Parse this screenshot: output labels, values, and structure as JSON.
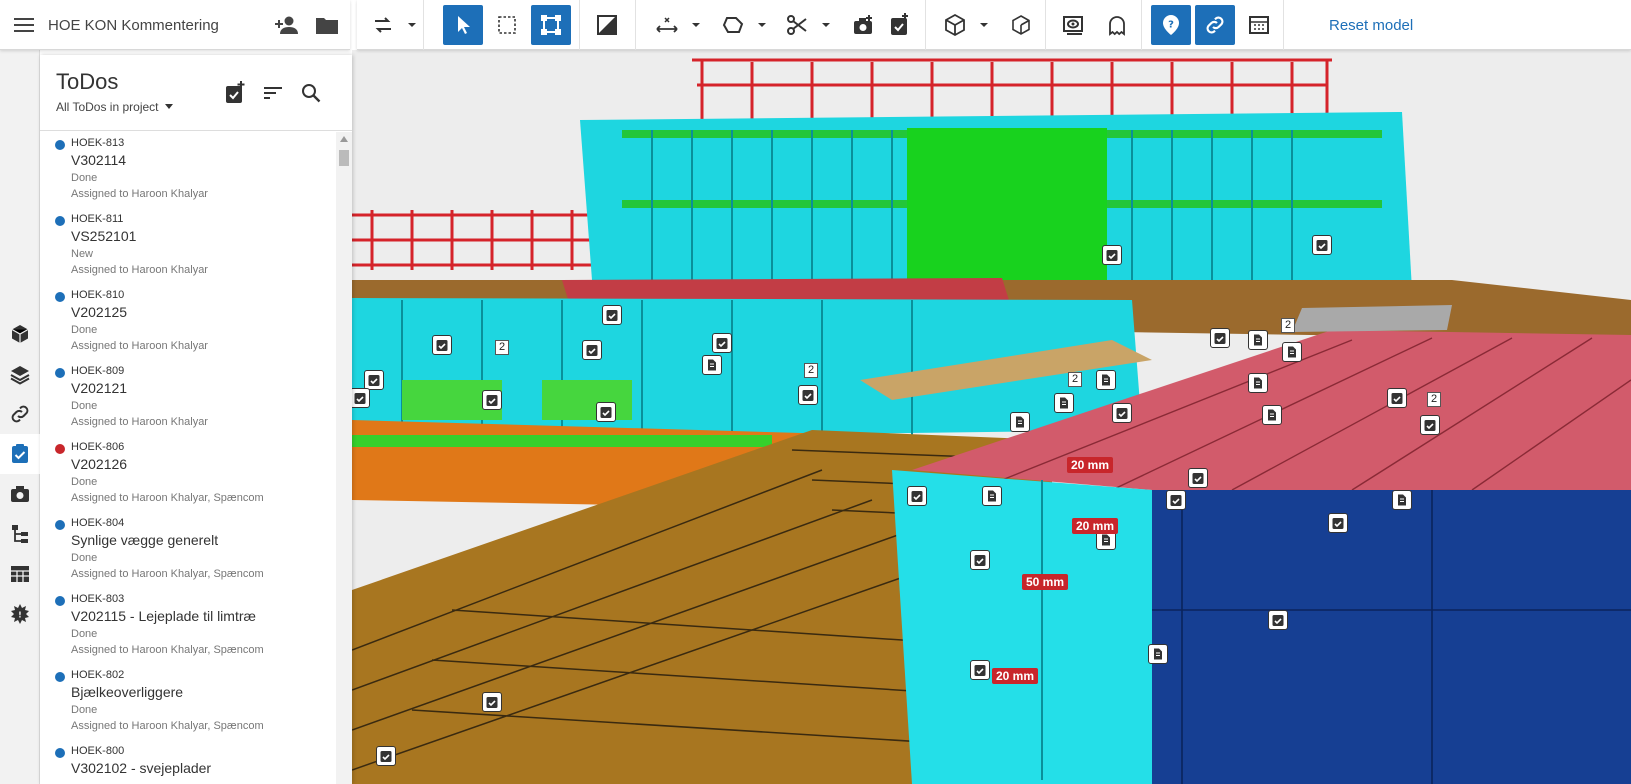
{
  "project": {
    "title": "HOE KON Kommentering"
  },
  "toolbar": {
    "reset_label": "Reset model"
  },
  "colors": {
    "accent": "#1d6fb8",
    "status_new_done": "#1d6fb8",
    "status_alert": "#c8262b"
  },
  "panel": {
    "title": "ToDos",
    "filter": "All ToDos in project",
    "items": [
      {
        "id": "HOEK-813",
        "name": "V302114",
        "status": "Done",
        "assigned": "Assigned to Haroon Khalyar",
        "color": "#1d6fb8"
      },
      {
        "id": "HOEK-811",
        "name": "VS252101",
        "status": "New",
        "assigned": "Assigned to Haroon Khalyar",
        "color": "#1d6fb8"
      },
      {
        "id": "HOEK-810",
        "name": "V202125",
        "status": "Done",
        "assigned": "Assigned to Haroon Khalyar",
        "color": "#1d6fb8"
      },
      {
        "id": "HOEK-809",
        "name": "V202121",
        "status": "Done",
        "assigned": "Assigned to Haroon Khalyar",
        "color": "#1d6fb8"
      },
      {
        "id": "HOEK-806",
        "name": "V202126",
        "status": "Done",
        "assigned": "Assigned to Haroon Khalyar, Spæncom",
        "color": "#c8262b"
      },
      {
        "id": "HOEK-804",
        "name": "Synlige vægge generelt",
        "status": "Done",
        "assigned": "Assigned to Haroon Khalyar, Spæncom",
        "color": "#1d6fb8"
      },
      {
        "id": "HOEK-803",
        "name": "V202115 - Lejeplade til limtræ",
        "status": "Done",
        "assigned": "Assigned to Haroon Khalyar, Spæncom",
        "color": "#1d6fb8"
      },
      {
        "id": "HOEK-802",
        "name": "Bjælkeoverliggere",
        "status": "Done",
        "assigned": "Assigned to Haroon Khalyar, Spæncom",
        "color": "#1d6fb8"
      },
      {
        "id": "HOEK-800",
        "name": "V302102 - svejeplader",
        "status": "",
        "assigned": "",
        "color": "#1d6fb8"
      }
    ]
  },
  "viewer": {
    "counts": [
      "2",
      "2",
      "2",
      "2",
      "2"
    ],
    "measurements": [
      "20 mm",
      "20 mm",
      "50 mm",
      "20 mm"
    ]
  }
}
